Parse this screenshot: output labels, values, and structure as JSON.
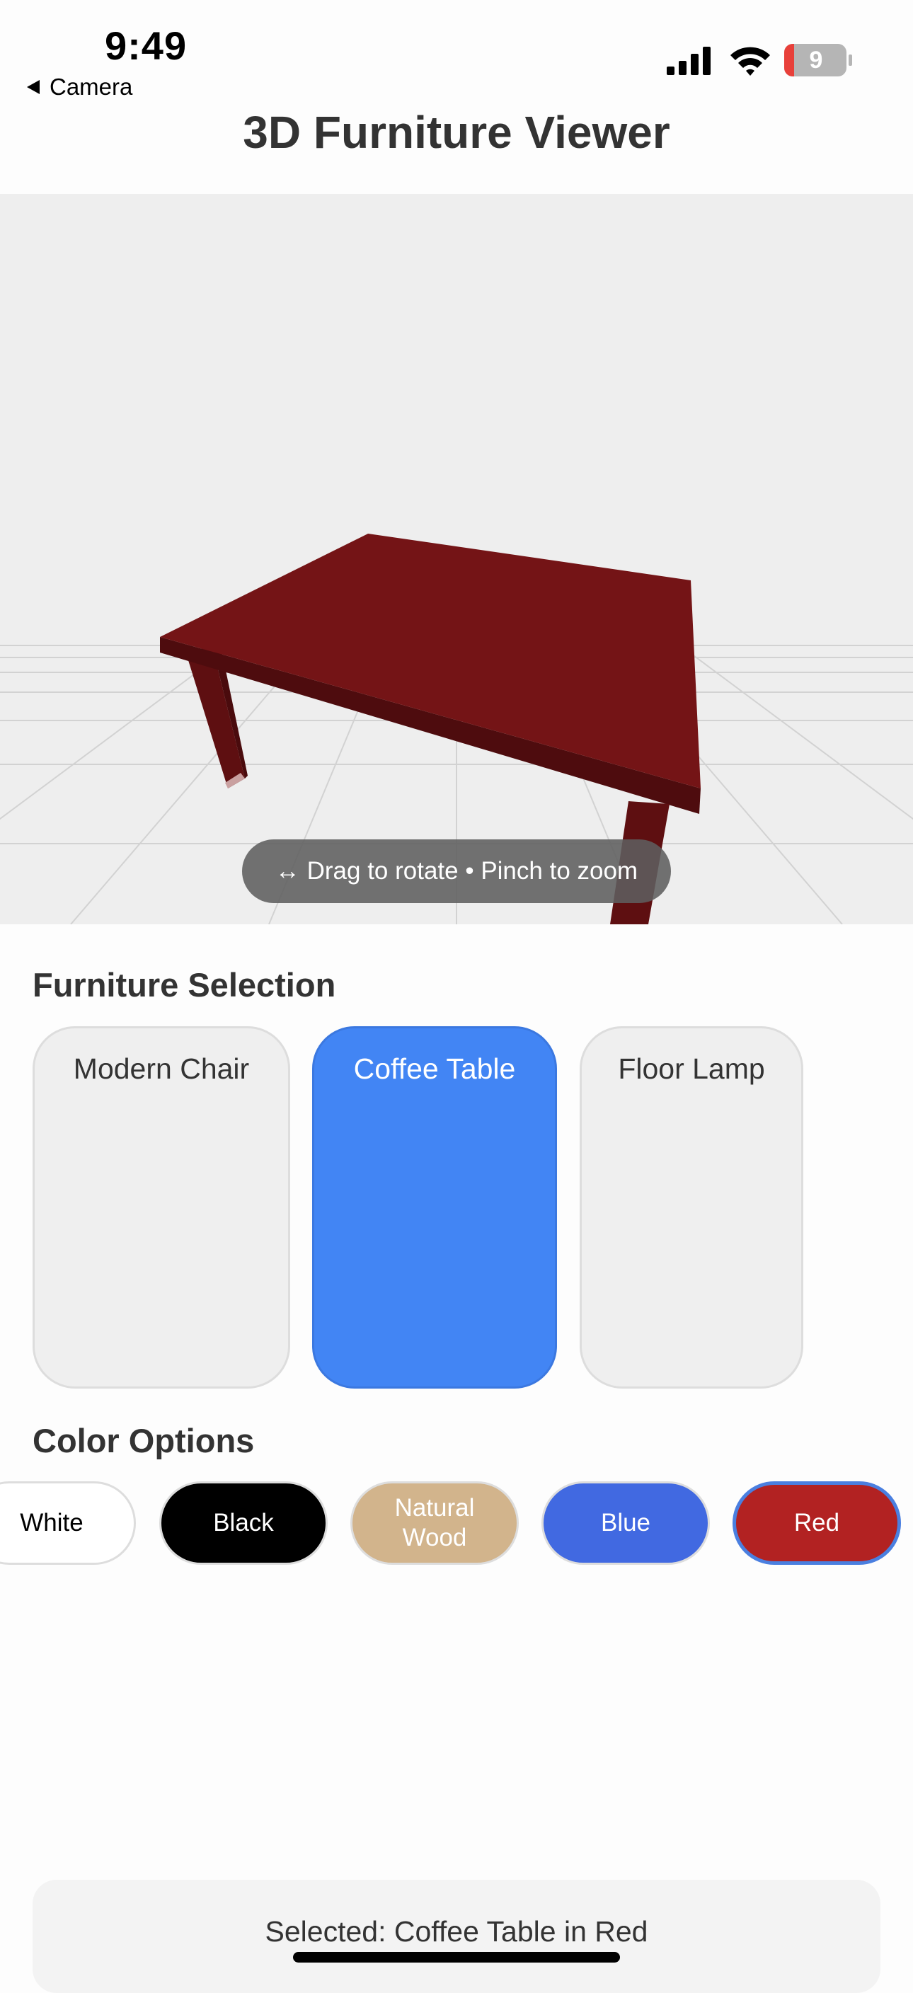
{
  "status_bar": {
    "time": "9:49",
    "back_label": "Camera",
    "battery_level": "9"
  },
  "header": {
    "title": "3D Furniture Viewer"
  },
  "viewer": {
    "hint": "↔ Drag to rotate • Pinch to zoom",
    "model_color": "#741416"
  },
  "furniture": {
    "section_title": "Furniture Selection",
    "items": [
      {
        "label": "Modern Chair",
        "selected": false
      },
      {
        "label": "Coffee Table",
        "selected": true
      },
      {
        "label": "Floor Lamp",
        "selected": false
      }
    ]
  },
  "colors": {
    "section_title": "Color Options",
    "items": [
      {
        "label": "White",
        "background": "#ffffff",
        "text_color": "#000000",
        "selected": false
      },
      {
        "label": "Black",
        "background": "#000000",
        "text_color": "#ffffff",
        "selected": false
      },
      {
        "label": "Natural\nWood",
        "background": "#d2b48c",
        "text_color": "#ffffff",
        "selected": false
      },
      {
        "label": "Blue",
        "background": "#4169e1",
        "text_color": "#ffffff",
        "selected": false
      },
      {
        "label": "Red",
        "background": "#b22222",
        "text_color": "#ffffff",
        "selected": true
      }
    ]
  },
  "footer": {
    "selected_text": "Selected: Coffee Table in Red"
  }
}
